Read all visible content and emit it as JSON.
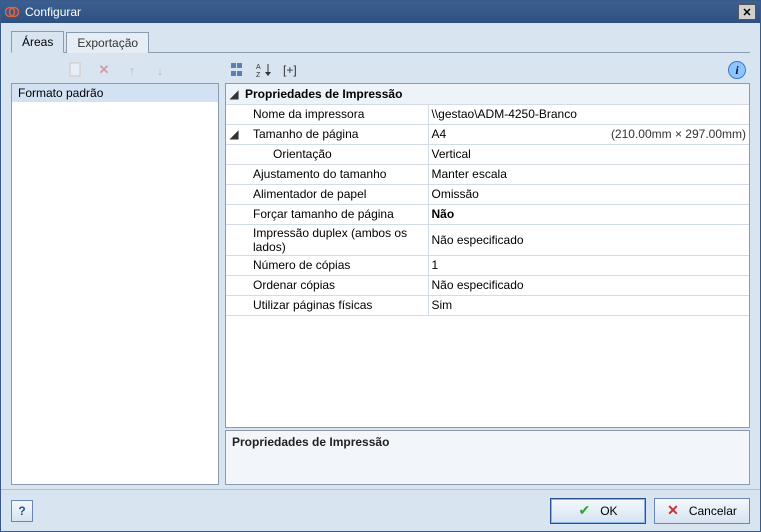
{
  "window": {
    "title": "Configurar"
  },
  "tabs": {
    "areas": "Áreas",
    "exportacao": "Exportação"
  },
  "toolbar": {
    "expand_label": "[+]"
  },
  "leftpane": {
    "items": [
      "Formato padrão"
    ]
  },
  "propgrid": {
    "group_title": "Propriedades de Impressão",
    "rows": [
      {
        "label": "Nome da impressora",
        "value": "\\\\gestao\\ADM-4250-Branco"
      },
      {
        "label": "Tamanho de página",
        "value": "A4",
        "extra": "(210.00mm × 297.00mm)",
        "expandable": true
      },
      {
        "label": "Orientação",
        "value": "Vertical",
        "indent": 2
      },
      {
        "label": "Ajustamento do tamanho",
        "value": "Manter escala"
      },
      {
        "label": "Alimentador de papel",
        "value": "Omissão"
      },
      {
        "label": "Forçar tamanho de página",
        "value": "Não",
        "bold": true
      },
      {
        "label": "Impressão duplex (ambos os lados)",
        "value": "Não especificado"
      },
      {
        "label": "Número de cópias",
        "value": "1"
      },
      {
        "label": "Ordenar cópias",
        "value": "Não especificado"
      },
      {
        "label": "Utilizar páginas físicas",
        "value": "Sim"
      }
    ]
  },
  "description": {
    "title": "Propriedades de Impressão"
  },
  "footer": {
    "help": "?",
    "ok": "OK",
    "cancel": "Cancelar"
  }
}
